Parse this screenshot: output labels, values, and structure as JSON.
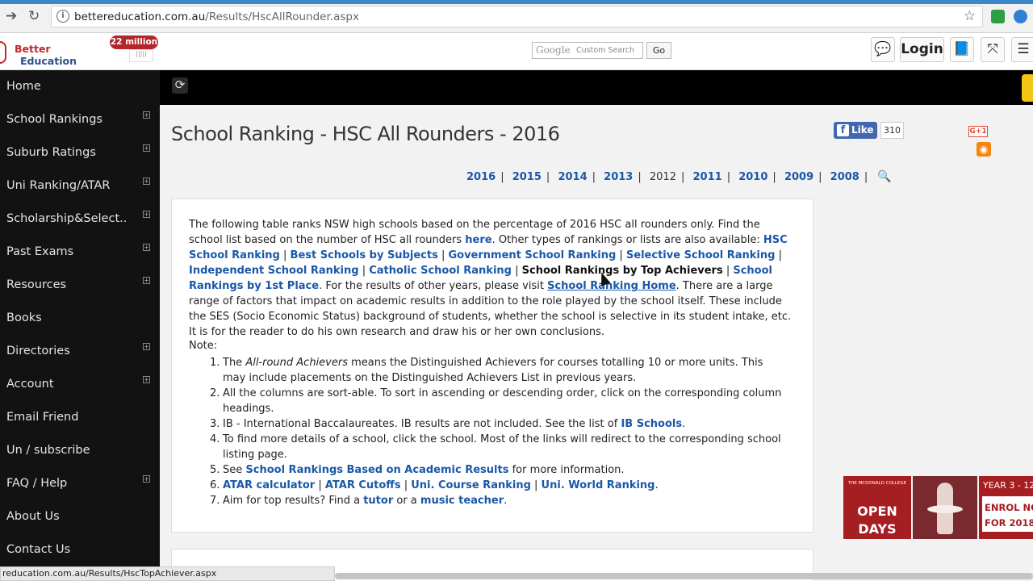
{
  "browser": {
    "url_host": "bettereducation.com.au",
    "url_path": "/Results/HscAllRounder.aspx"
  },
  "header": {
    "logo_line1": "Better",
    "logo_line2": "Education",
    "badge": "22 million",
    "search_placeholder": "Custom Search",
    "search_brand": "Google",
    "go_label": "Go",
    "login_label": "Login"
  },
  "sidebar": {
    "items": [
      {
        "label": "Home",
        "expandable": false
      },
      {
        "label": "School Rankings",
        "expandable": true
      },
      {
        "label": "Suburb Ratings",
        "expandable": true
      },
      {
        "label": "Uni Ranking/ATAR",
        "expandable": true
      },
      {
        "label": "Scholarship&Select..",
        "expandable": true
      },
      {
        "label": "Past Exams",
        "expandable": true
      },
      {
        "label": "Resources",
        "expandable": true
      },
      {
        "label": "Books",
        "expandable": false
      },
      {
        "label": "Directories",
        "expandable": true
      },
      {
        "label": "Account",
        "expandable": true
      },
      {
        "label": "Email Friend",
        "expandable": false
      },
      {
        "label": "Un / subscribe",
        "expandable": false
      },
      {
        "label": "FAQ / Help",
        "expandable": true
      },
      {
        "label": "About Us",
        "expandable": false
      },
      {
        "label": "Contact Us",
        "expandable": false
      }
    ]
  },
  "page": {
    "title": "School Ranking - HSC All Rounders - 2016",
    "fb_like": "Like",
    "fb_count": "310",
    "gplus": "G+1",
    "years": [
      "2016",
      "2015",
      "2014",
      "2013",
      "2012",
      "2011",
      "2010",
      "2009",
      "2008"
    ],
    "current_year": "2012"
  },
  "intro": {
    "t1": "The following table ranks NSW high schools based on the percentage of 2016 HSC all rounders only. Find the school list based on the number of HSC all rounders ",
    "here": "here",
    "t2": ".  Other types of rankings or lists are also available: ",
    "l_hsc": "HSC School Ranking",
    "l_best": "Best Schools by Subjects",
    "l_gov": "Government School Ranking",
    "l_sel": "Selective School Ranking",
    "l_ind": "Independent School Ranking",
    "l_cath": "Catholic School Ranking",
    "l_top": "School Rankings by Top Achievers",
    "l_first": "School Rankings by 1st Place",
    "t3": "For the results of other years, please visit ",
    "l_home": "School Ranking Home",
    "t4": ". There are a large range of factors that impact on academic results in addition to the role played by the school itself. These include the SES (Socio Economic Status) background of students, whether the school is selective in its student intake, etc. It is for the reader to do his own research and draw his or her own conclusions.",
    "sep": " | "
  },
  "notes": {
    "heading": "Note:",
    "n1_a": "The ",
    "n1_em": "All-round Achievers",
    "n1_b": " means the Distinguished Achievers for courses totalling 10 or more units. This may include placements on the Distinguished Achievers List in previous years.",
    "n2": "All the columns are sort-able. To sort in ascending or descending order, click on the corresponding column headings.",
    "n3_a": "IB - International Baccalaureates. IB results are not included. See the list of ",
    "n3_link": "IB Schools",
    "n4": "To find more details of a school, click the school. Most of the links will redirect to the corresponding school listing page.",
    "n5_a": "See ",
    "n5_link": "School Rankings Based on Academic Results",
    "n5_b": " for more information.",
    "n6_l1": "ATAR calculator",
    "n6_l2": "ATAR Cutoffs",
    "n6_l3": "Uni. Course Ranking",
    "n6_l4": "Uni. World Ranking",
    "n7_a": "Aim for top results? Find a ",
    "n7_l1": "tutor",
    "n7_b": " or a ",
    "n7_l2": "music teacher"
  },
  "ad": {
    "college": "THE MCDONALD COLLEGE",
    "open_line1": "OPEN",
    "open_line2": "DAYS",
    "year": "YEAR 3 - 12",
    "enrol": "ENROL NOW",
    "for": "FOR 2018"
  },
  "status": {
    "text": "reducation.com.au/Results/HscTopAchiever.aspx"
  }
}
